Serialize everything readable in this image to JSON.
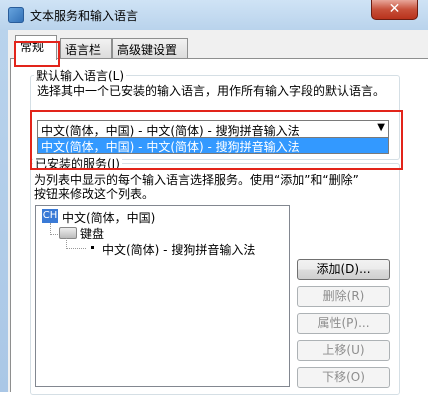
{
  "window": {
    "title": "文本服务和输入语言",
    "close_label": "✕"
  },
  "tabs": [
    {
      "label": "常规"
    },
    {
      "label": "语言栏"
    },
    {
      "label": "高级键设置"
    }
  ],
  "default_input": {
    "group_title": "默认输入语言(L)",
    "description": "选择其中一个已安装的输入语言，用作所有输入字段的默认语言。",
    "selected_value": "中文(简体，中国) - 中文(简体) - 搜狗拼音输入法",
    "dropdown_option": "中文(简体，中国) - 中文(简体) - 搜狗拼音输入法"
  },
  "installed_services": {
    "group_title": "已安装的服务(I)",
    "description_line1": "为列表中显示的每个输入语言选择服务。使用“添加”和“删除”",
    "description_line2": "按钮来修改这个列表。",
    "tree": {
      "language_badge": "CH",
      "language": "中文(简体，中国)",
      "category": "键盘",
      "service": "中文(简体) - 搜狗拼音输入法"
    }
  },
  "buttons": {
    "add": "添加(D)...",
    "remove": "删除(R)",
    "properties": "属性(P)...",
    "move_up": "上移(U)",
    "move_down": "下移(O)"
  },
  "colors": {
    "highlight_border": "#e2241a",
    "selection": "#3399ff",
    "close_button": "#c7503a"
  }
}
